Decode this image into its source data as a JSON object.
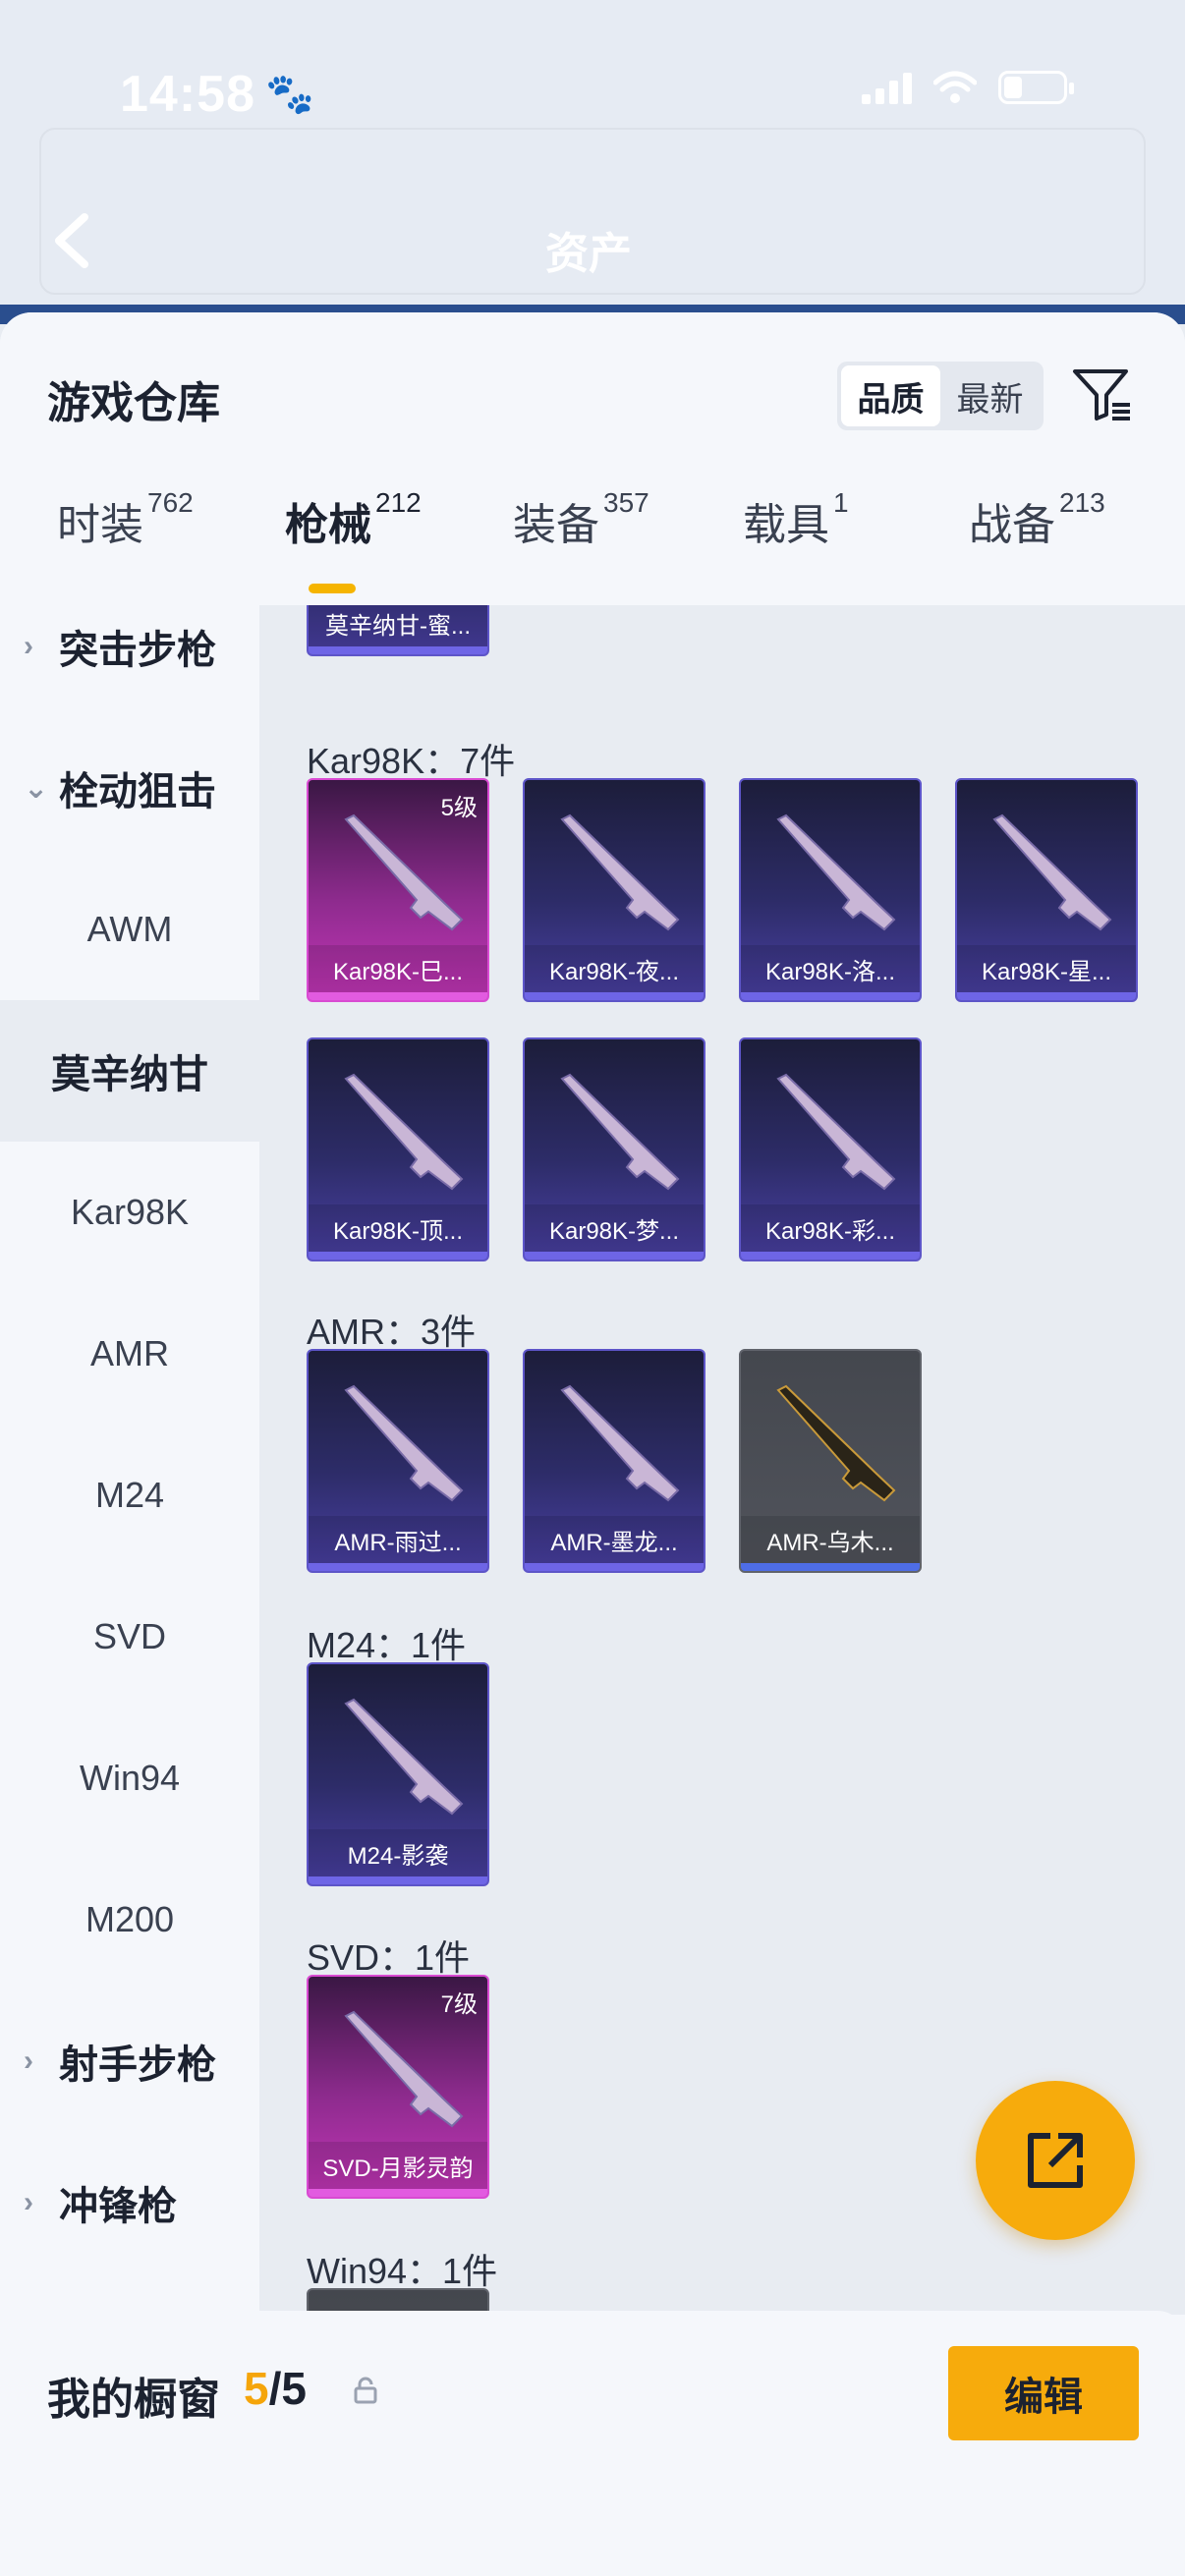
{
  "status_bar": {
    "time": "14:58"
  },
  "header": {
    "title": "资产"
  },
  "sheet": {
    "title": "游戏仓库",
    "sort": {
      "options": [
        "品质",
        "最新"
      ],
      "active": "品质"
    },
    "tabs": [
      {
        "label": "时装",
        "count": "762"
      },
      {
        "label": "枪械",
        "count": "212",
        "active": true
      },
      {
        "label": "装备",
        "count": "357"
      },
      {
        "label": "载具",
        "count": "1"
      },
      {
        "label": "战备",
        "count": "213"
      }
    ]
  },
  "sidebar": {
    "items": [
      {
        "label": "突击步枪",
        "type": "group",
        "expanded": false
      },
      {
        "label": "栓动狙击",
        "type": "group",
        "expanded": true
      },
      {
        "label": "AWM",
        "type": "item"
      },
      {
        "label": "莫辛纳甘",
        "type": "item",
        "selected": true
      },
      {
        "label": "Kar98K",
        "type": "item"
      },
      {
        "label": "AMR",
        "type": "item"
      },
      {
        "label": "M24",
        "type": "item"
      },
      {
        "label": "SVD",
        "type": "item"
      },
      {
        "label": "Win94",
        "type": "item"
      },
      {
        "label": "M200",
        "type": "item"
      },
      {
        "label": "射手步枪",
        "type": "group",
        "expanded": false
      },
      {
        "label": "冲锋枪",
        "type": "group",
        "expanded": false
      }
    ]
  },
  "content": {
    "partial_top_card": {
      "name": "莫辛纳甘-蜜..."
    },
    "sections": [
      {
        "title": "Kar98K：7件",
        "cards": [
          {
            "name": "Kar98K-巳...",
            "level": "5级",
            "rarity": "pink"
          },
          {
            "name": "Kar98K-夜...",
            "rarity": "purple"
          },
          {
            "name": "Kar98K-洛...",
            "rarity": "purple"
          },
          {
            "name": "Kar98K-星...",
            "rarity": "purple"
          },
          {
            "name": "Kar98K-顶...",
            "rarity": "purple"
          },
          {
            "name": "Kar98K-梦...",
            "rarity": "purple"
          },
          {
            "name": "Kar98K-彩...",
            "rarity": "purple"
          }
        ]
      },
      {
        "title": "AMR：3件",
        "cards": [
          {
            "name": "AMR-雨过...",
            "rarity": "purple"
          },
          {
            "name": "AMR-墨龙...",
            "rarity": "purple"
          },
          {
            "name": "AMR-乌木...",
            "rarity": "gray"
          }
        ]
      },
      {
        "title": "M24：1件",
        "cards": [
          {
            "name": "M24-影袭",
            "rarity": "purple"
          }
        ]
      },
      {
        "title": "SVD：1件",
        "cards": [
          {
            "name": "SVD-月影灵韵",
            "level": "7级",
            "rarity": "pink"
          }
        ]
      },
      {
        "title": "Win94：1件",
        "cards": []
      }
    ]
  },
  "bottom": {
    "label": "我的橱窗",
    "current": "5",
    "separator": "/",
    "max": "5",
    "edit_label": "编辑"
  },
  "colors": {
    "accent": "#f7ab0c",
    "purple_card": "#4a40a4",
    "pink_card": "#c436b8",
    "gray_card": "#51545c"
  }
}
